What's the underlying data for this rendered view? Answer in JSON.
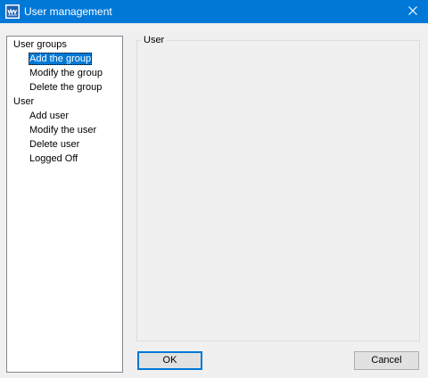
{
  "window": {
    "title": "User management",
    "icon": "app-logo-icon",
    "close_icon": "close-icon"
  },
  "tree": {
    "groups": [
      {
        "label": "User groups",
        "children": [
          "Add the group",
          "Modify the group",
          "Delete the group"
        ]
      },
      {
        "label": "User",
        "children": [
          "Add user",
          "Modify the user",
          "Delete user",
          "Logged Off"
        ]
      }
    ],
    "selected": "Add the group"
  },
  "panel": {
    "title": "User"
  },
  "buttons": {
    "ok_label": "OK",
    "cancel_label": "Cancel"
  },
  "colors": {
    "titlebar": "#0078d7",
    "selection": "#0078d7",
    "window_bg": "#f0f0f0"
  }
}
